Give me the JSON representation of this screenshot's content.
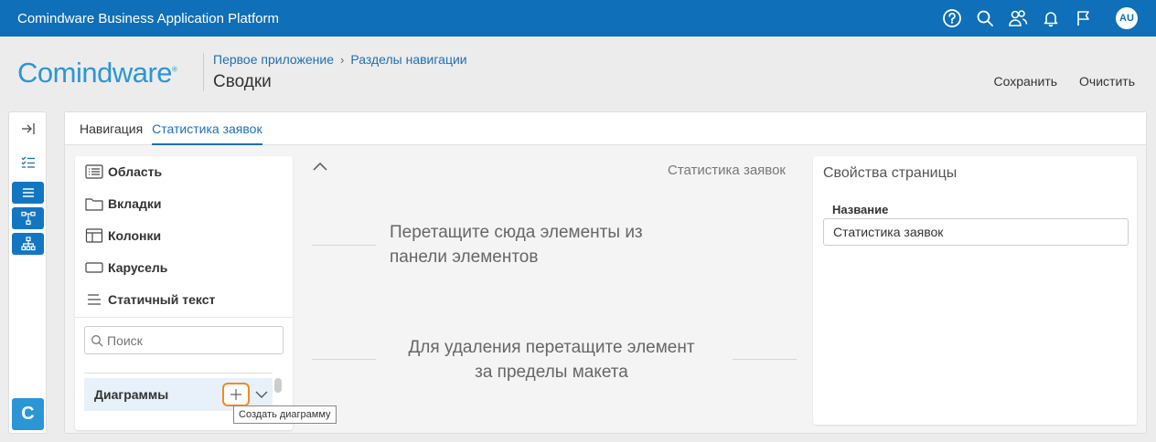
{
  "topbar": {
    "title": "Comindware Business Application Platform",
    "icons": [
      "help-icon",
      "search-icon",
      "users-icon",
      "bell-icon",
      "flag-icon"
    ],
    "avatar": "AU",
    "bg_color": "#0f6fb8"
  },
  "header": {
    "logo": "Comindware",
    "logo_mark": "®",
    "breadcrumb": [
      "Первое приложение",
      "Разделы навигации"
    ],
    "breadcrumb_sep": "›",
    "title": "Сводки",
    "actions": {
      "save": "Сохранить",
      "clear": "Очистить"
    }
  },
  "leftrail": {
    "items": [
      "collapse-panel-icon",
      "checklist-icon",
      "list-icon",
      "flow-icon",
      "hierarchy-icon"
    ],
    "logo": "C"
  },
  "tabs": [
    {
      "label": "Навигация",
      "active": false
    },
    {
      "label": "Статистика заявок",
      "active": true
    }
  ],
  "palette": {
    "items": [
      {
        "label": "Область",
        "icon": "area-icon"
      },
      {
        "label": "Вкладки",
        "icon": "folder-icon"
      },
      {
        "label": "Колонки",
        "icon": "columns-icon"
      },
      {
        "label": "Карусель",
        "icon": "carousel-icon"
      },
      {
        "label": "Статичный текст",
        "icon": "text-icon"
      }
    ],
    "search_placeholder": "Поиск",
    "group": "Диаграммы",
    "tooltip": "Создать диаграмму"
  },
  "canvas": {
    "title": "Статистика заявок",
    "drop_hint_1": "Перетащите сюда элементы из",
    "drop_hint_2": "панели элементов",
    "delete_hint_1": "Для удаления перетащите элемент",
    "delete_hint_2": "за пределы макета"
  },
  "props": {
    "title": "Свойства страницы",
    "name_label": "Название",
    "name_value": "Статистика заявок"
  },
  "colors": {
    "accent": "#1f6fb2",
    "highlight": "#f08a24"
  }
}
